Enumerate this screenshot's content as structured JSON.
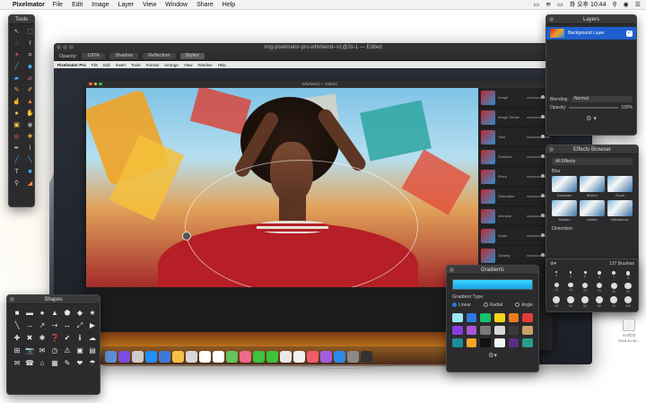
{
  "menubar": {
    "app_name": "Pixelmator",
    "items": [
      "File",
      "Edit",
      "Image",
      "Layer",
      "View",
      "Window",
      "Share",
      "Help"
    ],
    "clock": "화 오후 10:44"
  },
  "main_window": {
    "title": "img-pixelmator-pro-whirlwind--v1@2x-1 — Edited",
    "opacity_label": "Opacity:",
    "opacity_value": "100%",
    "toolbar_tabs": [
      "Shadow",
      "Reflection",
      "Styles"
    ],
    "inner_menu": {
      "app": "Pixelmator Pro",
      "items": [
        "File",
        "Edit",
        "Insert",
        "Tools",
        "Format",
        "Arrange",
        "View",
        "Window",
        "Help"
      ]
    },
    "inner_window_title": "Whirlwind — Edited",
    "inner_effects": [
      "Image",
      "Image Stroke",
      "Twirl",
      "Gradient",
      "Pinch",
      "Saturation",
      "Intensity",
      "Scale",
      "Opacity"
    ]
  },
  "tools_panel": {
    "title": "Tools",
    "icons": [
      "arrow-icon",
      "rect-select-icon",
      "ellipse-select-icon",
      "lasso-icon",
      "magic-wand-icon",
      "crop-icon",
      "eyedropper-icon",
      "paint-bucket-icon",
      "gradient-icon",
      "eraser-icon",
      "brush-icon",
      "pencil-icon",
      "smudge-icon",
      "sharpen-icon",
      "dodge-icon",
      "burn-icon",
      "sponge-icon",
      "clone-icon",
      "red-eye-icon",
      "repair-icon",
      "pen-icon",
      "freeform-pen-icon",
      "shape-icon",
      "line-icon",
      "type-icon",
      "hand-icon",
      "zoom-icon",
      "color-icon"
    ]
  },
  "shapes_panel": {
    "title": "Shapes",
    "glyphs": [
      "■",
      "▬",
      "●",
      "▲",
      "⬟",
      "◆",
      "★",
      "╲",
      "→",
      "↗",
      "⇢",
      "↔",
      "⤢",
      "▶",
      "✚",
      "✖",
      "✱",
      "❓",
      "✔",
      "ℹ",
      "☁",
      "⊞",
      "📷",
      "✉",
      "◷",
      "⚠",
      "▣",
      "▤",
      "✉",
      "☎",
      "⌂",
      "▦",
      "✎",
      "❤",
      "☂",
      "✿",
      "⚙",
      "♥",
      "☗",
      "✈",
      "⬣",
      "✦",
      "☖",
      "▲"
    ]
  },
  "layers_panel": {
    "title": "Layers",
    "layer_name": "Background Layer",
    "blending_label": "Blending:",
    "blending_value": "Normal",
    "opacity_label": "Opacity:",
    "opacity_value": "100%"
  },
  "effects_browser": {
    "title": "Effects Browser",
    "filter": "All Effects",
    "section_blur": "Blur",
    "blur_effects": [
      "Gaussian",
      "Motion",
      "Zoom",
      "Median",
      "Soften",
      "Miniaturize"
    ],
    "section_distortion": "Distortion"
  },
  "gradients_panel": {
    "title": "Gradients",
    "type_label": "Gradient Type",
    "types": [
      "Linear",
      "Radial",
      "Angle"
    ],
    "selected_type": "Linear",
    "swatch_colors": [
      "#9be8f7",
      "#2b7be0",
      "#13c46a",
      "#f2d41b",
      "#f07a1f",
      "#e23c3c",
      "#8a3ddf",
      "#a855d8",
      "#7a7a7a",
      "#d8d8d8",
      "#3a3a3a",
      "#c9a06c",
      "#1b8d9a",
      "#f5a623",
      "#111111",
      "#f5f5f5",
      "#5b2c87",
      "#2a9d8f"
    ]
  },
  "brushes_panel": {
    "count_label": "137 Brushes",
    "sizes": [
      "3",
      "4",
      "5",
      "6",
      "7",
      "8",
      "10",
      "15",
      "20",
      "25",
      "30",
      "35",
      "45",
      "50",
      "60",
      "65",
      "70",
      "100",
      "100",
      "100",
      "100",
      "100"
    ]
  },
  "desktop_folder": {
    "label": "스크린샷 2018-10-30..."
  },
  "colors": {
    "accent": "#1f5fd0",
    "panel_bg": "#2b2b2d",
    "gradient_start": "#38d6ff",
    "gradient_end": "#1ba4e7"
  }
}
